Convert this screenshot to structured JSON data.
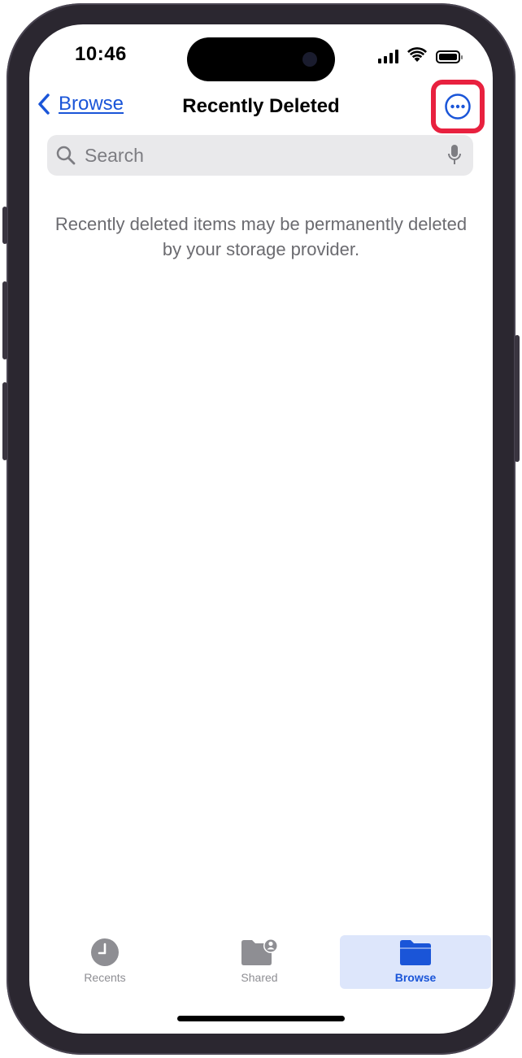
{
  "status_bar": {
    "time": "10:46"
  },
  "nav": {
    "back_label": "Browse",
    "title": "Recently Deleted"
  },
  "search": {
    "placeholder": "Search"
  },
  "info_message": "Recently deleted items may be permanently deleted by your storage provider.",
  "tabs": [
    {
      "label": "Recents",
      "icon": "clock-icon",
      "active": false
    },
    {
      "label": "Shared",
      "icon": "shared-folder-icon",
      "active": false
    },
    {
      "label": "Browse",
      "icon": "folder-icon",
      "active": true
    }
  ],
  "colors": {
    "accent": "#1a55d8",
    "highlight": "#e8213f",
    "inactive_tab": "#8e8e93",
    "active_tab_bg": "#dde6fb"
  }
}
